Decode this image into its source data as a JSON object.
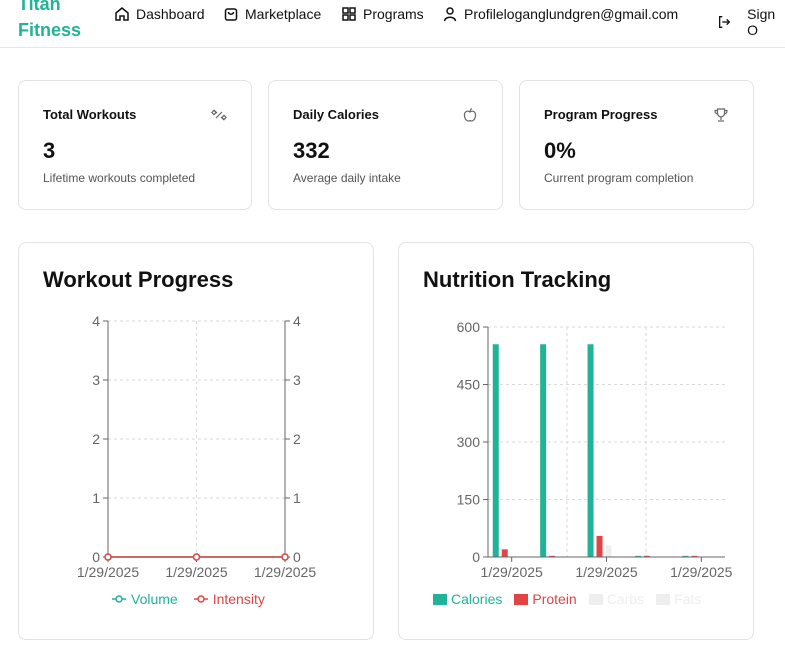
{
  "brand": {
    "line1": "Titan",
    "line2": "Fitness",
    "color": "#21b398"
  },
  "nav": {
    "dashboard": "Dashboard",
    "marketplace": "Marketplace",
    "programs": "Programs",
    "profile": "Profileloganglundgren@gmail.com",
    "signout": "Sign O"
  },
  "stats": [
    {
      "title": "Total Workouts",
      "value": "3",
      "sub": "Lifetime workouts completed",
      "icon": "dumbbell-icon"
    },
    {
      "title": "Daily Calories",
      "value": "332",
      "sub": "Average daily intake",
      "icon": "apple-icon"
    },
    {
      "title": "Program Progress",
      "value": "0%",
      "sub": "Current program completion",
      "icon": "trophy-icon"
    }
  ],
  "workout": {
    "title": "Workout Progress",
    "legend": {
      "volume": "Volume",
      "intensity": "Intensity"
    }
  },
  "nutrition": {
    "title": "Nutrition Tracking",
    "legend": {
      "calories": "Calories",
      "protein": "Protein",
      "carbs": "Carbs",
      "fats": "Fats"
    }
  },
  "chart_data": [
    {
      "type": "line",
      "title": "Workout Progress",
      "x": [
        "1/29/2025",
        "1/29/2025",
        "1/29/2025"
      ],
      "ylim": [
        0,
        4
      ],
      "yticks": [
        0,
        1,
        2,
        3,
        4
      ],
      "y2lim": [
        0,
        4
      ],
      "y2ticks": [
        0,
        1,
        2,
        3,
        4
      ],
      "series": [
        {
          "name": "Volume",
          "values": [
            0,
            0,
            0
          ],
          "color": "#21b398"
        },
        {
          "name": "Intensity",
          "values": [
            0,
            0,
            0
          ],
          "color": "#e04444"
        }
      ],
      "grid": true,
      "legend": "bottom"
    },
    {
      "type": "bar",
      "title": "Nutrition Tracking",
      "categories": [
        "1/29/2025",
        "",
        "1/29/2025",
        "",
        "1/29/2025"
      ],
      "ylim": [
        0,
        600
      ],
      "yticks": [
        0,
        150,
        300,
        450,
        600
      ],
      "series": [
        {
          "name": "Calories",
          "values": [
            555,
            555,
            555,
            3,
            3
          ],
          "color": "#21b398"
        },
        {
          "name": "Protein",
          "values": [
            20,
            3,
            55,
            3,
            3
          ],
          "color": "#e04444"
        },
        {
          "name": "Carbs",
          "values": [
            0,
            0,
            30,
            0,
            0
          ],
          "color": "#eeeeee"
        },
        {
          "name": "Fats",
          "values": [
            0,
            0,
            0,
            0,
            0
          ],
          "color": "#eeeeee"
        }
      ],
      "grid": true,
      "legend": "bottom"
    }
  ]
}
